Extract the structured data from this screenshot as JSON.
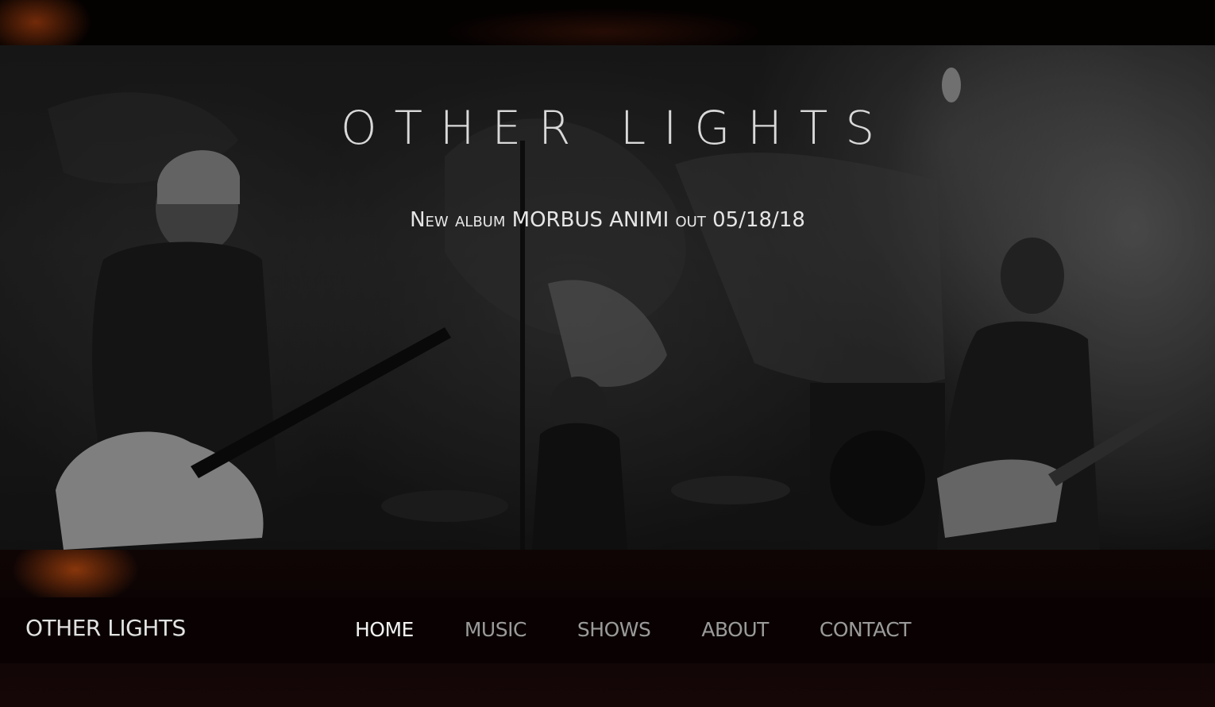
{
  "hero": {
    "title": "OTHER LIGHTS",
    "subtitle_prefix": "New album",
    "subtitle_album": "MORBUS ANIMI",
    "subtitle_mid": "out",
    "subtitle_date": "05/18/18",
    "image_description_icon": "band-photo"
  },
  "navbar": {
    "brand": "OTHER LIGHTS",
    "links": [
      {
        "label": "HOME",
        "active": true
      },
      {
        "label": "MUSIC",
        "active": false
      },
      {
        "label": "SHOWS",
        "active": false
      },
      {
        "label": "ABOUT",
        "active": false
      },
      {
        "label": "CONTACT",
        "active": false
      }
    ]
  },
  "colors": {
    "background": "#0a0202",
    "accent_glow": "#8c370a",
    "nav_active": "#f2f2f2",
    "nav_inactive": "#9a9a9a"
  }
}
